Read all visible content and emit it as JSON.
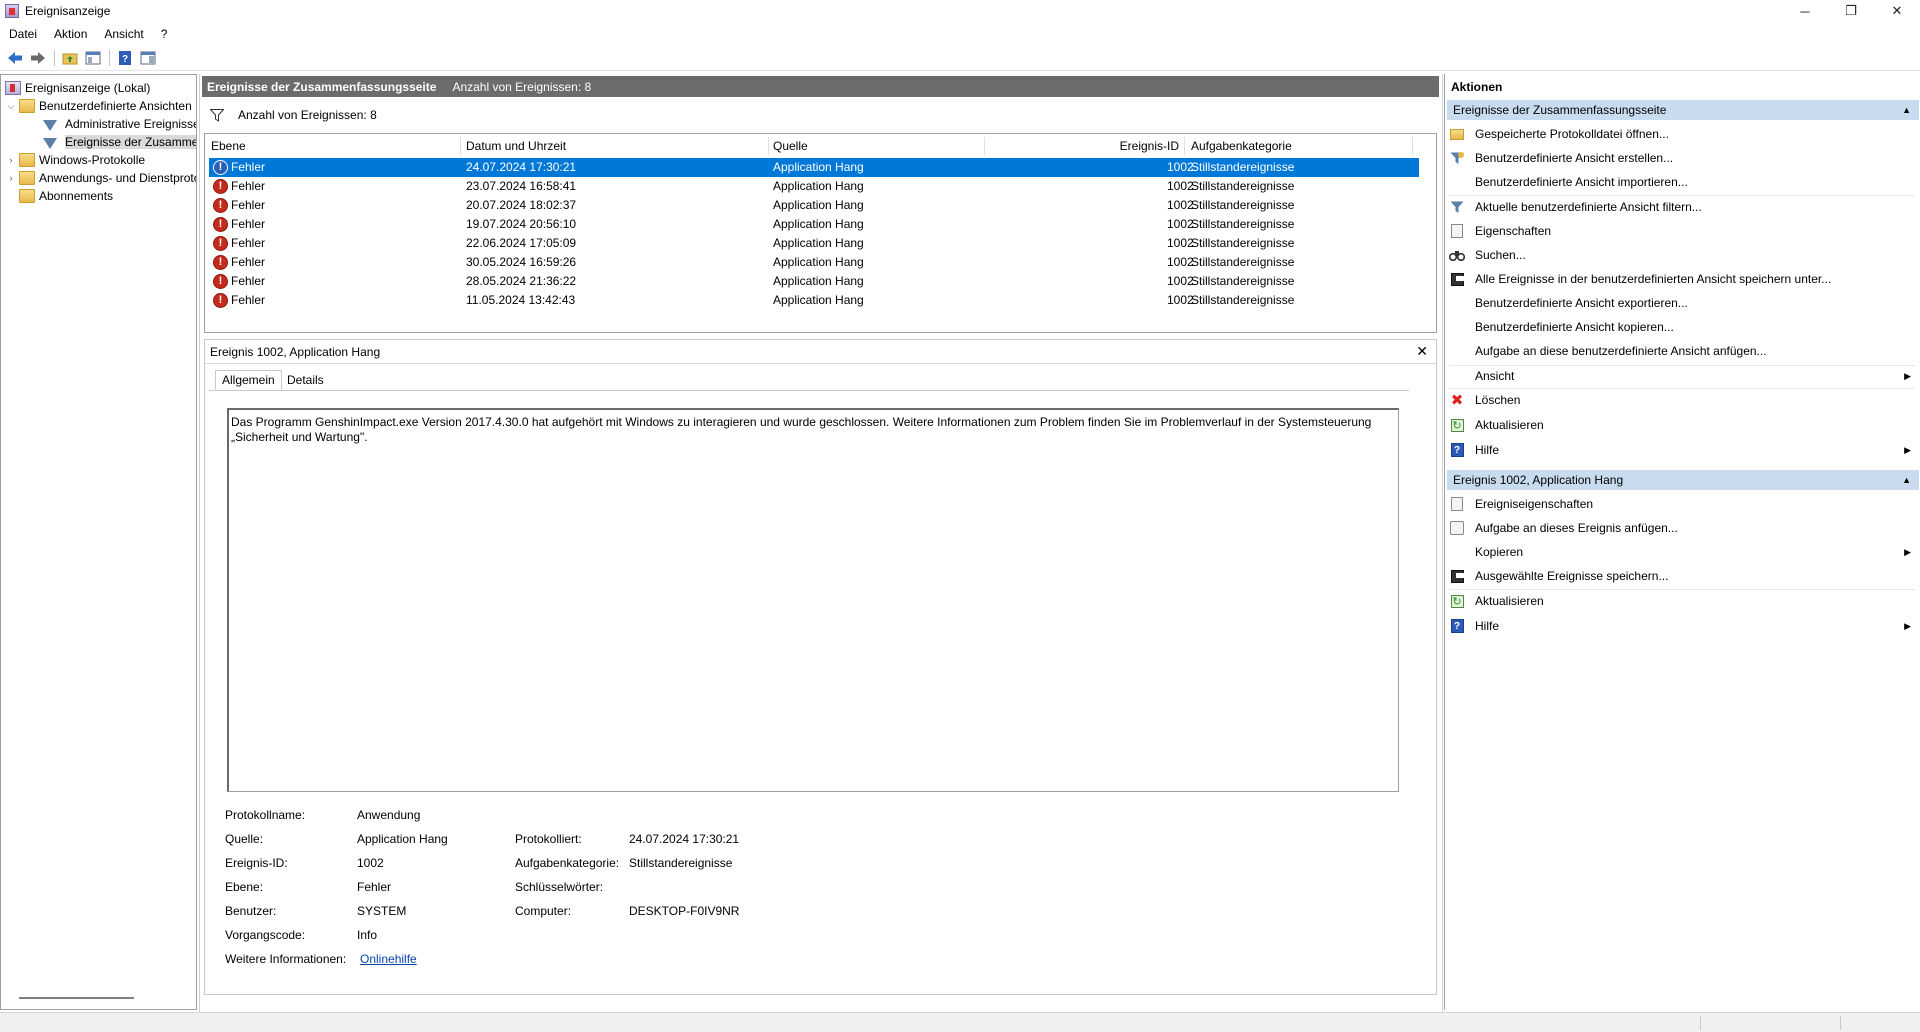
{
  "window": {
    "title": "Ereignisanzeige",
    "minimize_glyph": "─",
    "restore_glyph": "❐",
    "close_glyph": "✕"
  },
  "menu": [
    "Datei",
    "Aktion",
    "Ansicht",
    "?"
  ],
  "tree": {
    "root": "Ereignisanzeige (Lokal)",
    "custom_views": "Benutzerdefinierte Ansichten",
    "admin_events": "Administrative Ereignisse",
    "summary_events": "Ereignisse der Zusammenfassungsseite",
    "windows_logs": "Windows-Protokolle",
    "app_logs": "Anwendungs- und Dienstprotokolle",
    "subscriptions": "Abonnements"
  },
  "center": {
    "header_title": "Ereignisse der Zusammenfassungsseite",
    "header_count": "Anzahl von Ereignissen: 8",
    "filter_count": "Anzahl von Ereignissen: 8",
    "columns": {
      "level": "Ebene",
      "datetime": "Datum und Uhrzeit",
      "source": "Quelle",
      "event_id": "Ereignis-ID",
      "category": "Aufgabenkategorie"
    },
    "events": [
      {
        "level": "Fehler",
        "datetime": "24.07.2024 17:30:21",
        "source": "Application Hang",
        "event_id": "1002",
        "category": "Stillstandereignisse"
      },
      {
        "level": "Fehler",
        "datetime": "23.07.2024 16:58:41",
        "source": "Application Hang",
        "event_id": "1002",
        "category": "Stillstandereignisse"
      },
      {
        "level": "Fehler",
        "datetime": "20.07.2024 18:02:37",
        "source": "Application Hang",
        "event_id": "1002",
        "category": "Stillstandereignisse"
      },
      {
        "level": "Fehler",
        "datetime": "19.07.2024 20:56:10",
        "source": "Application Hang",
        "event_id": "1002",
        "category": "Stillstandereignisse"
      },
      {
        "level": "Fehler",
        "datetime": "22.06.2024 17:05:09",
        "source": "Application Hang",
        "event_id": "1002",
        "category": "Stillstandereignisse"
      },
      {
        "level": "Fehler",
        "datetime": "30.05.2024 16:59:26",
        "source": "Application Hang",
        "event_id": "1002",
        "category": "Stillstandereignisse"
      },
      {
        "level": "Fehler",
        "datetime": "28.05.2024 21:36:22",
        "source": "Application Hang",
        "event_id": "1002",
        "category": "Stillstandereignisse"
      },
      {
        "level": "Fehler",
        "datetime": "11.05.2024 13:42:43",
        "source": "Application Hang",
        "event_id": "1002",
        "category": "Stillstandereignisse"
      }
    ]
  },
  "detail": {
    "title": "Ereignis 1002, Application Hang",
    "close_glyph": "✕",
    "tab_general": "Allgemein",
    "tab_details": "Details",
    "message_line1": "Das Programm GenshinImpact.exe Version 2017.4.30.0 hat aufgehört mit Windows zu interagieren und wurde geschlossen. Weitere Informationen zum Problem finden Sie im Problemverlauf in der Systemsteuerung",
    "message_line2": "„Sicherheit und Wartung\".",
    "labels": {
      "log_name": "Protokollname:",
      "source": "Quelle:",
      "event_id": "Ereignis-ID:",
      "level": "Ebene:",
      "user": "Benutzer:",
      "opcode": "Vorgangscode:",
      "more_info": "Weitere Informationen:",
      "logged": "Protokolliert:",
      "task_category": "Aufgabenkategorie:",
      "keywords": "Schlüsselwörter:",
      "computer": "Computer:"
    },
    "values": {
      "log_name": "Anwendung",
      "source": "Application Hang",
      "event_id": "1002",
      "level": "Fehler",
      "user": "SYSTEM",
      "opcode": "Info",
      "more_info": "Onlinehilfe",
      "logged": "24.07.2024 17:30:21",
      "task_category": "Stillstandereignisse",
      "keywords": "",
      "computer": "DESKTOP-F0IV9NR"
    }
  },
  "actions": {
    "title": "Aktionen",
    "section1": "Ereignisse der Zusammenfassungsseite",
    "section1_items": [
      "Gespeicherte Protokolldatei öffnen...",
      "Benutzerdefinierte Ansicht erstellen...",
      "Benutzerdefinierte Ansicht importieren...",
      "Aktuelle benutzerdefinierte Ansicht filtern...",
      "Eigenschaften",
      "Suchen...",
      "Alle Ereignisse in der benutzerdefinierten Ansicht speichern unter...",
      "Benutzerdefinierte Ansicht exportieren...",
      "Benutzerdefinierte Ansicht kopieren...",
      "Aufgabe an diese benutzerdefinierte Ansicht anfügen...",
      "Ansicht",
      "Löschen",
      "Aktualisieren",
      "Hilfe"
    ],
    "section2": "Ereignis 1002, Application Hang",
    "section2_items": [
      "Ereigniseigenschaften",
      "Aufgabe an dieses Ereignis anfügen...",
      "Kopieren",
      "Ausgewählte Ereignisse speichern...",
      "Aktualisieren",
      "Hilfe"
    ]
  }
}
